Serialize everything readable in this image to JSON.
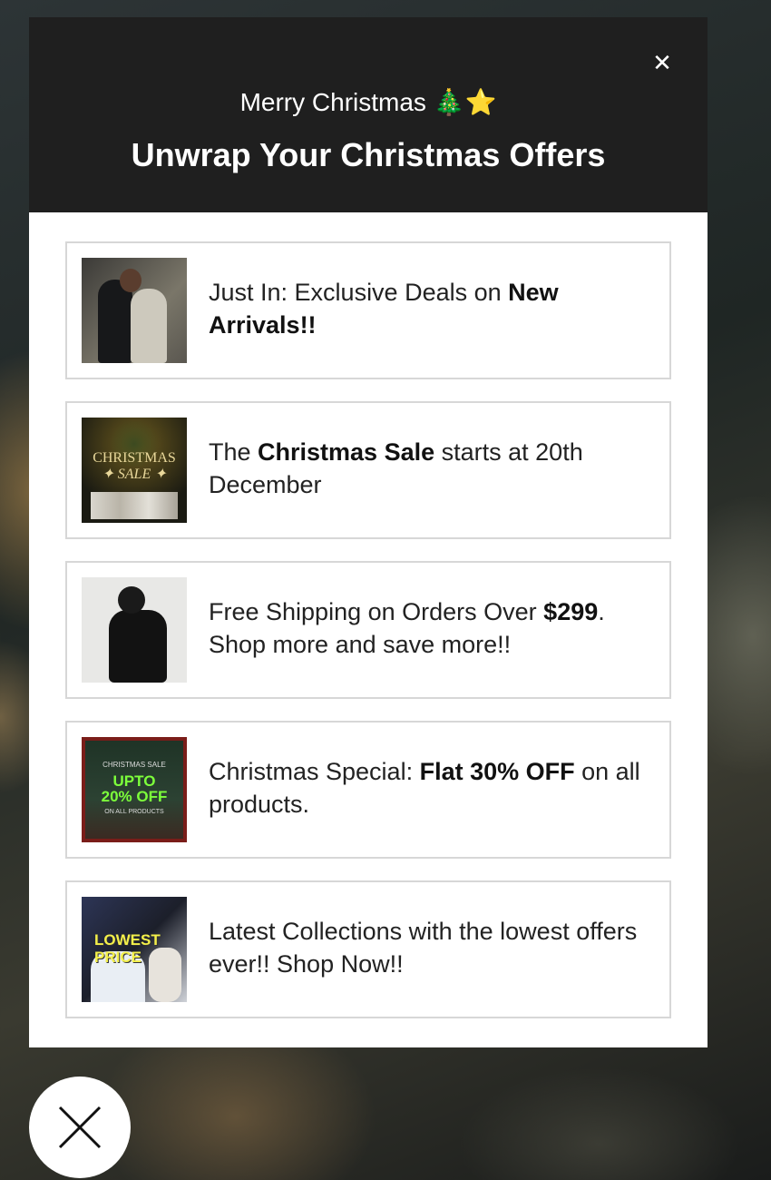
{
  "modal": {
    "subtitle": "Merry Christmas 🎄⭐",
    "title": "Unwrap Your Christmas Offers",
    "close_icon": "close-icon"
  },
  "offers": [
    {
      "parts": [
        "Just In: Exclusive Deals on ",
        "New Arrivals!!",
        ""
      ],
      "image_alt": "new-arrivals-thumbnail"
    },
    {
      "parts": [
        "The ",
        "Christmas Sale",
        " starts at 20th December"
      ],
      "image_alt": "christmas-sale-thumbnail",
      "image_text": [
        "CHRISTMAS",
        "✦ SALE ✦"
      ]
    },
    {
      "parts": [
        "Free Shipping on Orders Over ",
        "$299",
        ". Shop more and save more!!"
      ],
      "image_alt": "free-shipping-thumbnail"
    },
    {
      "parts": [
        "Christmas Special: ",
        "Flat 30% OFF",
        " on all products."
      ],
      "image_alt": "christmas-special-thumbnail",
      "image_text": [
        "CHRISTMAS SALE",
        "UPTO",
        "20% OFF",
        "ON ALL PRODUCTS"
      ]
    },
    {
      "parts": [
        "Latest Collections with the lowest offers ever!! Shop Now!!",
        "",
        ""
      ],
      "image_alt": "latest-collections-thumbnail",
      "image_text": [
        "LOWEST",
        "PRICE"
      ]
    }
  ],
  "bottom_close": {
    "icon": "close-icon"
  }
}
